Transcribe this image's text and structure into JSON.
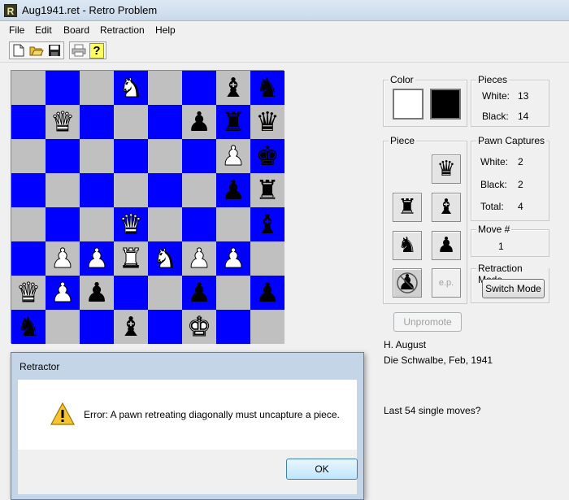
{
  "window": {
    "title": "Aug1941.ret - Retro Problem",
    "app_icon_letter": "R"
  },
  "menu": [
    "File",
    "Edit",
    "Board",
    "Retraction",
    "Help"
  ],
  "toolbar": {
    "buttons": [
      "new-file-icon",
      "open-folder-icon",
      "save-icon",
      "print-icon",
      "help-icon"
    ],
    "help_glyph": "?"
  },
  "board": {
    "light_color": "#c0c0c0",
    "dark_color": "#0000ff",
    "rows": [
      [
        "",
        "",
        "",
        "wN",
        "",
        "",
        "bB",
        "bN"
      ],
      [
        "",
        "wQ",
        "",
        "",
        "",
        "bP",
        "bR",
        "bQ"
      ],
      [
        "",
        "",
        "",
        "",
        "",
        "",
        "wP",
        "bK"
      ],
      [
        "",
        "",
        "",
        "",
        "",
        "",
        "bP",
        "bR"
      ],
      [
        "",
        "",
        "",
        "wQ",
        "",
        "",
        "",
        "bB"
      ],
      [
        "",
        "wP",
        "wP",
        "wR",
        "wN",
        "wP",
        "wP",
        ""
      ],
      [
        "wQ",
        "wP",
        "bP",
        "",
        "",
        "bP",
        "",
        "bP"
      ],
      [
        "bN",
        "",
        "",
        "bB",
        "",
        "wK",
        "",
        ""
      ]
    ]
  },
  "color_panel": {
    "label": "Color",
    "white_swatch": "#ffffff",
    "black_swatch": "#000000"
  },
  "pieces_panel": {
    "label": "Pieces",
    "white_label": "White:",
    "white_value": "13",
    "black_label": "Black:",
    "black_value": "14"
  },
  "piece_panel": {
    "label": "Piece",
    "buttons": [
      "bQ",
      "bR",
      "bB",
      "bN",
      "bP",
      "bP-crossed"
    ],
    "ep_label": "e.p."
  },
  "pawn_captures": {
    "label": "Pawn Captures",
    "white_label": "White:",
    "white_value": "2",
    "black_label": "Black:",
    "black_value": "2",
    "total_label": "Total:",
    "total_value": "4"
  },
  "move_panel": {
    "label": "Move #",
    "value": "1"
  },
  "retraction_mode": {
    "label": "Retraction Mode",
    "button": "Switch Mode"
  },
  "unpromote_button": "Unpromote",
  "problem_info": {
    "author": "H. August",
    "source": "Die Schwalbe, Feb, 1941",
    "stipulation": "Last 54 single moves?"
  },
  "dialog": {
    "title": "Retractor",
    "message": "Error: A pawn retreating diagonally must uncapture a piece.",
    "ok": "OK",
    "icon": "warning-icon"
  }
}
